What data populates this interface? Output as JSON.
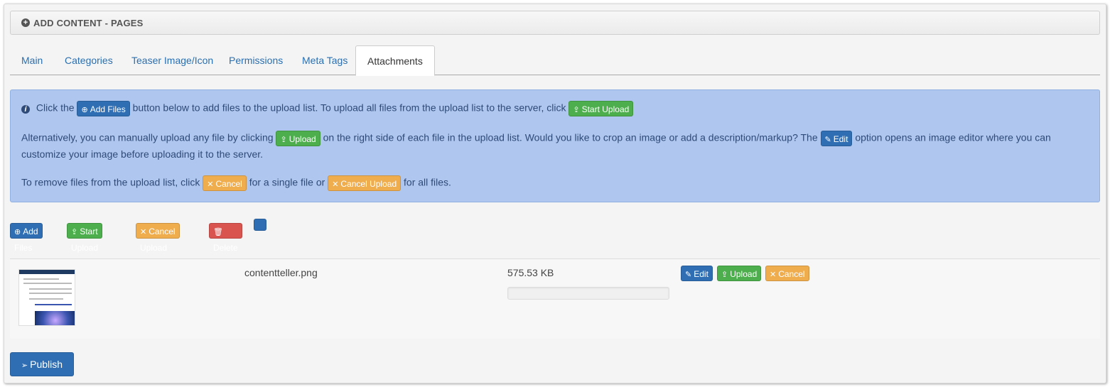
{
  "header": {
    "title": "ADD CONTENT - PAGES",
    "icon": "plus-circle-icon"
  },
  "tabs": [
    {
      "label": "Main"
    },
    {
      "label": "Categories"
    },
    {
      "label": "Teaser Image/Icon"
    },
    {
      "label": "Permissions"
    },
    {
      "label": "Meta Tags"
    },
    {
      "label": "Attachments",
      "active": true
    }
  ],
  "info": {
    "l1_a": "Click the",
    "l1_btn": "Add Files",
    "l1_b": "button below to add files to the upload list. To upload all files from the upload list to the server, click",
    "l1_btn2": "Start Upload",
    "l2_a": "Alternatively, you can manually upload any file by clicking",
    "l2_btn": "Upload",
    "l2_b": "on the right side of each file in the upload list. Would you like to crop an image or add a description/markup? The",
    "l2_btn2": "Edit",
    "l2_c": "option opens an image editor where you can",
    "l3": "customize your image before uploading it to the server.",
    "l4_a": "To remove files from the upload list, click",
    "l4_btn": "Cancel",
    "l4_b": "for a single file or",
    "l4_btn2": "Cancel Upload",
    "l4_c": "for all files."
  },
  "toolbar": {
    "add_files": "Add Files",
    "start_upload": "Start Upload",
    "cancel_upload": "Cancel Upload",
    "delete": "Delete"
  },
  "file": {
    "name": "contentteller.png",
    "size": "575.53 KB",
    "progress": 0,
    "edit": "Edit",
    "upload": "Upload",
    "cancel": "Cancel"
  },
  "publish": "Publish",
  "colors": {
    "primary": "#2f6eb3",
    "success": "#4cae4c",
    "warning": "#f0ad4e",
    "danger": "#d9534f",
    "info_bg": "#afc7ef"
  }
}
